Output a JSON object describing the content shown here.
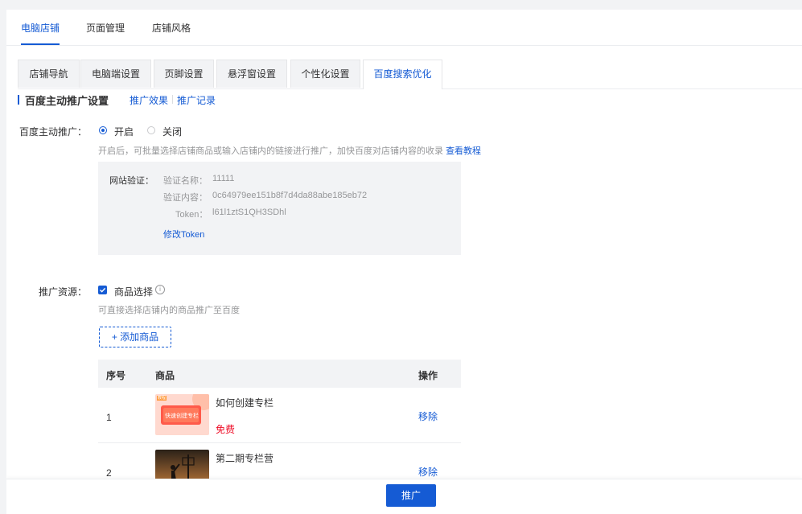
{
  "top_tabs": [
    {
      "label": "电脑店铺",
      "active": true
    },
    {
      "label": "页面管理",
      "active": false
    },
    {
      "label": "店铺风格",
      "active": false
    }
  ],
  "sub_tabs": [
    {
      "label": "店铺导航",
      "active": false
    },
    {
      "label": "电脑端设置",
      "active": false
    },
    {
      "label": "页脚设置",
      "active": false
    },
    {
      "label": "悬浮窗设置",
      "active": false
    },
    {
      "label": "个性化设置",
      "active": false
    },
    {
      "label": "百度搜索优化",
      "active": true
    }
  ],
  "section": {
    "title": "百度主动推广设置",
    "link_effect": "推广效果",
    "link_records": "推广记录"
  },
  "promotion_switch": {
    "label": "百度主动推广：",
    "on_label": "开启",
    "off_label": "关闭",
    "selected": "开启",
    "help_text": "开启后，可批量选择店铺商品或输入店铺内的链接进行推广，加快百度对店铺内容的收录",
    "help_link": "查看教程"
  },
  "site_verify": {
    "label": "网站验证：",
    "name_label": "验证名称：",
    "name_value": "11111",
    "content_label": "验证内容：",
    "content_value": "0c64979ee151b8f7d4da88abe185eb72",
    "token_label": "Token：",
    "token_value": "l61l1ztS1QH3SDhl",
    "modify_link": "修改Token"
  },
  "resource": {
    "label": "推广资源：",
    "checkbox_label": "商品选择",
    "checked": true,
    "info_symbol": "i",
    "help_text": "可直接选择店铺内的商品推广至百度",
    "add_button": "+ 添加商品"
  },
  "table": {
    "headers": {
      "no": "序号",
      "goods": "商品",
      "action": "操作"
    },
    "rows": [
      {
        "no": "1",
        "name": "如何创建专栏",
        "price": "免费",
        "thumb_tag": "教程",
        "thumb_text": "快速创建专栏",
        "action": "移除"
      },
      {
        "no": "2",
        "name": "第二期专栏营",
        "price": "",
        "action": "移除"
      }
    ]
  },
  "footer": {
    "promote_button": "推广"
  },
  "colors": {
    "primary": "#155bd4",
    "price_red": "#ee0a24",
    "muted": "#969799",
    "panel_bg": "#f2f3f5"
  }
}
